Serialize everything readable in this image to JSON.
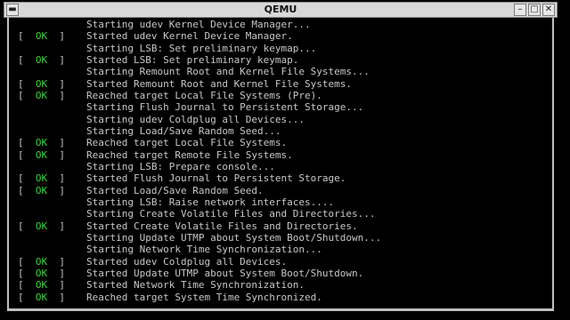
{
  "window": {
    "title": "QEMU"
  },
  "titlebar_buttons": {
    "menu": "▬",
    "minimize": "–",
    "maximize": "□",
    "close": "✕"
  },
  "colors": {
    "ok": "#3ad23a",
    "text": "#c8c8c8",
    "background": "#000000",
    "titlebar": "#d8d8d8"
  },
  "console": {
    "lines": [
      {
        "status": "",
        "text": "Starting udev Kernel Device Manager..."
      },
      {
        "status": "OK",
        "text": "Started udev Kernel Device Manager."
      },
      {
        "status": "",
        "text": "Starting LSB: Set preliminary keymap..."
      },
      {
        "status": "OK",
        "text": "Started LSB: Set preliminary keymap."
      },
      {
        "status": "",
        "text": "Starting Remount Root and Kernel File Systems..."
      },
      {
        "status": "OK",
        "text": "Started Remount Root and Kernel File Systems."
      },
      {
        "status": "OK",
        "text": "Reached target Local File Systems (Pre)."
      },
      {
        "status": "",
        "text": "Starting Flush Journal to Persistent Storage..."
      },
      {
        "status": "",
        "text": "Starting udev Coldplug all Devices..."
      },
      {
        "status": "",
        "text": "Starting Load/Save Random Seed..."
      },
      {
        "status": "OK",
        "text": "Reached target Local File Systems."
      },
      {
        "status": "OK",
        "text": "Reached target Remote File Systems."
      },
      {
        "status": "",
        "text": "Starting LSB: Prepare console..."
      },
      {
        "status": "OK",
        "text": "Started Flush Journal to Persistent Storage."
      },
      {
        "status": "OK",
        "text": "Started Load/Save Random Seed."
      },
      {
        "status": "",
        "text": "Starting LSB: Raise network interfaces...."
      },
      {
        "status": "",
        "text": "Starting Create Volatile Files and Directories..."
      },
      {
        "status": "OK",
        "text": "Started Create Volatile Files and Directories."
      },
      {
        "status": "",
        "text": "Starting Update UTMP about System Boot/Shutdown..."
      },
      {
        "status": "",
        "text": "Starting Network Time Synchronization..."
      },
      {
        "status": "OK",
        "text": "Started udev Coldplug all Devices."
      },
      {
        "status": "OK",
        "text": "Started Update UTMP about System Boot/Shutdown."
      },
      {
        "status": "OK",
        "text": "Started Network Time Synchronization."
      },
      {
        "status": "OK",
        "text": "Reached target System Time Synchronized."
      }
    ]
  }
}
